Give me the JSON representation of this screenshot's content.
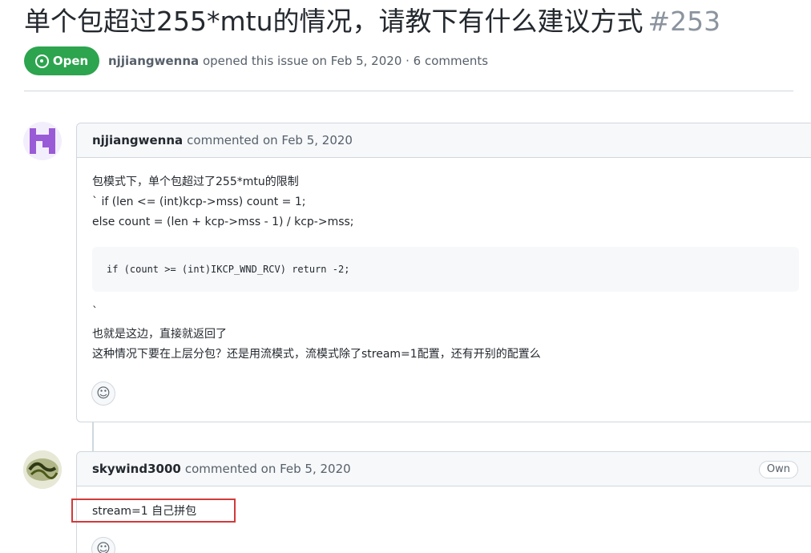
{
  "issue": {
    "title": "单个包超过255*mtu的情况，请教下有什么建议方式",
    "number": "#253",
    "state": "Open",
    "author": "njjiangwenna",
    "meta_text": "opened this issue on Feb 5, 2020 · 6 comments"
  },
  "comments": [
    {
      "author": "njjiangwenna",
      "meta": "commented on Feb 5, 2020",
      "lines_before": [
        "包模式下，单个包超过了255*mtu的限制",
        "` if (len <= (int)kcp->mss) count = 1;",
        "else count = (len + kcp->mss - 1) / kcp->mss;"
      ],
      "code": "if (count >= (int)IKCP_WND_RCV) return -2;",
      "tick": "`",
      "lines_after": [
        "也就是这边，直接就返回了",
        "这种情况下要在上层分包？还是用流模式，流模式除了stream=1配置，还有开别的配置么"
      ],
      "reaction_icon": "☺"
    },
    {
      "author": "skywind3000",
      "meta": "commented on Feb 5, 2020",
      "badge": "Own",
      "body": "stream=1 自己拼包",
      "reaction_icon": "☺"
    }
  ],
  "colors": {
    "open_green": "#2da44e",
    "highlight_red": "#d23a3a",
    "border": "#d0d7de"
  }
}
